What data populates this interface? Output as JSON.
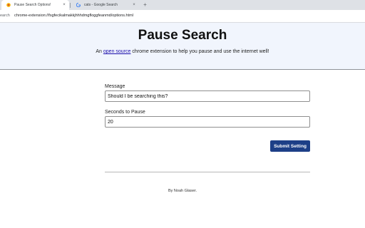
{
  "browser": {
    "tabs": [
      {
        "title": "Pause Search Options!",
        "active": true,
        "favicon": "extension-icon"
      },
      {
        "title": "cats - Google Search",
        "active": false,
        "favicon": "google-g-icon"
      }
    ],
    "new_tab_label": "+",
    "close_label": "×",
    "omnibox": {
      "prefix": "earch",
      "url": "chrome-extension://fsgfecikalmakkjhhhdmgfloggfeanmd/options.html"
    }
  },
  "header": {
    "title": "Pause Search",
    "subtitle_before": "An ",
    "subtitle_link": "open source",
    "subtitle_after": " chrome extension to help you pause and use the internet well!"
  },
  "form": {
    "message_label": "Message",
    "message_value": "Should I be searching this?",
    "seconds_label": "Seconds to Pause",
    "seconds_value": "20",
    "submit_label": "Submit Setting"
  },
  "footer": {
    "credit": "By Noah Glaser."
  },
  "colors": {
    "header_bg": "#f1f5fd",
    "button_bg": "#1d3f87",
    "link": "#1a0dab"
  }
}
